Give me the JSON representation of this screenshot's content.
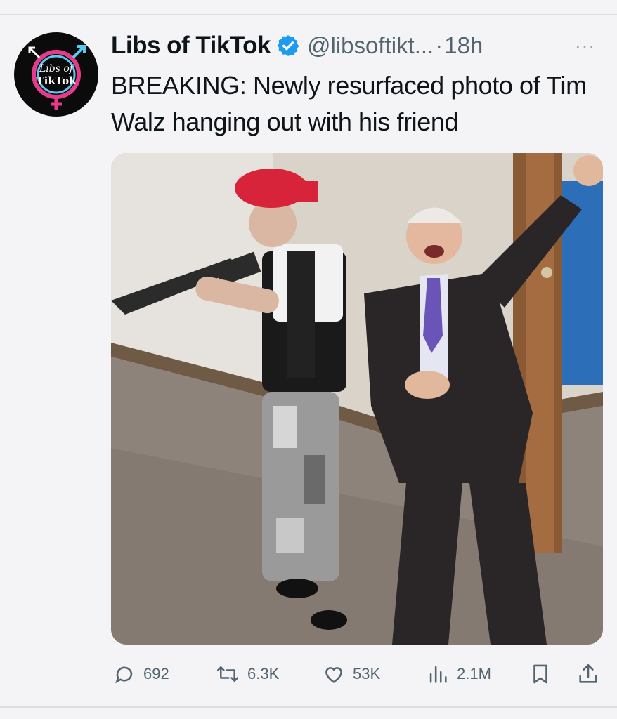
{
  "post": {
    "author": {
      "display_name": "Libs of TikTok",
      "handle": "@libsoftikt...",
      "avatar_text_line1": "Libs of",
      "avatar_text_line2": "TikTok",
      "verified": true
    },
    "separator": "·",
    "time": "18h",
    "more_label": "···",
    "text": "BREAKING: Newly resurfaced photo of Tim Walz hanging out with his friend",
    "media": {
      "type": "photo"
    },
    "actions": {
      "replies": "692",
      "reposts": "6.3K",
      "likes": "53K",
      "views": "2.1M"
    }
  },
  "icons": {
    "reply": "comment-icon",
    "repost": "repost-icon",
    "like": "heart-icon",
    "views": "analytics-icon",
    "bookmark": "bookmark-icon",
    "share": "share-icon",
    "verified": "verified-badge-icon"
  },
  "colors": {
    "text_primary": "#0f1419",
    "text_secondary": "#536471",
    "verified_blue": "#1d9bf0",
    "background": "#f4f4f6"
  }
}
